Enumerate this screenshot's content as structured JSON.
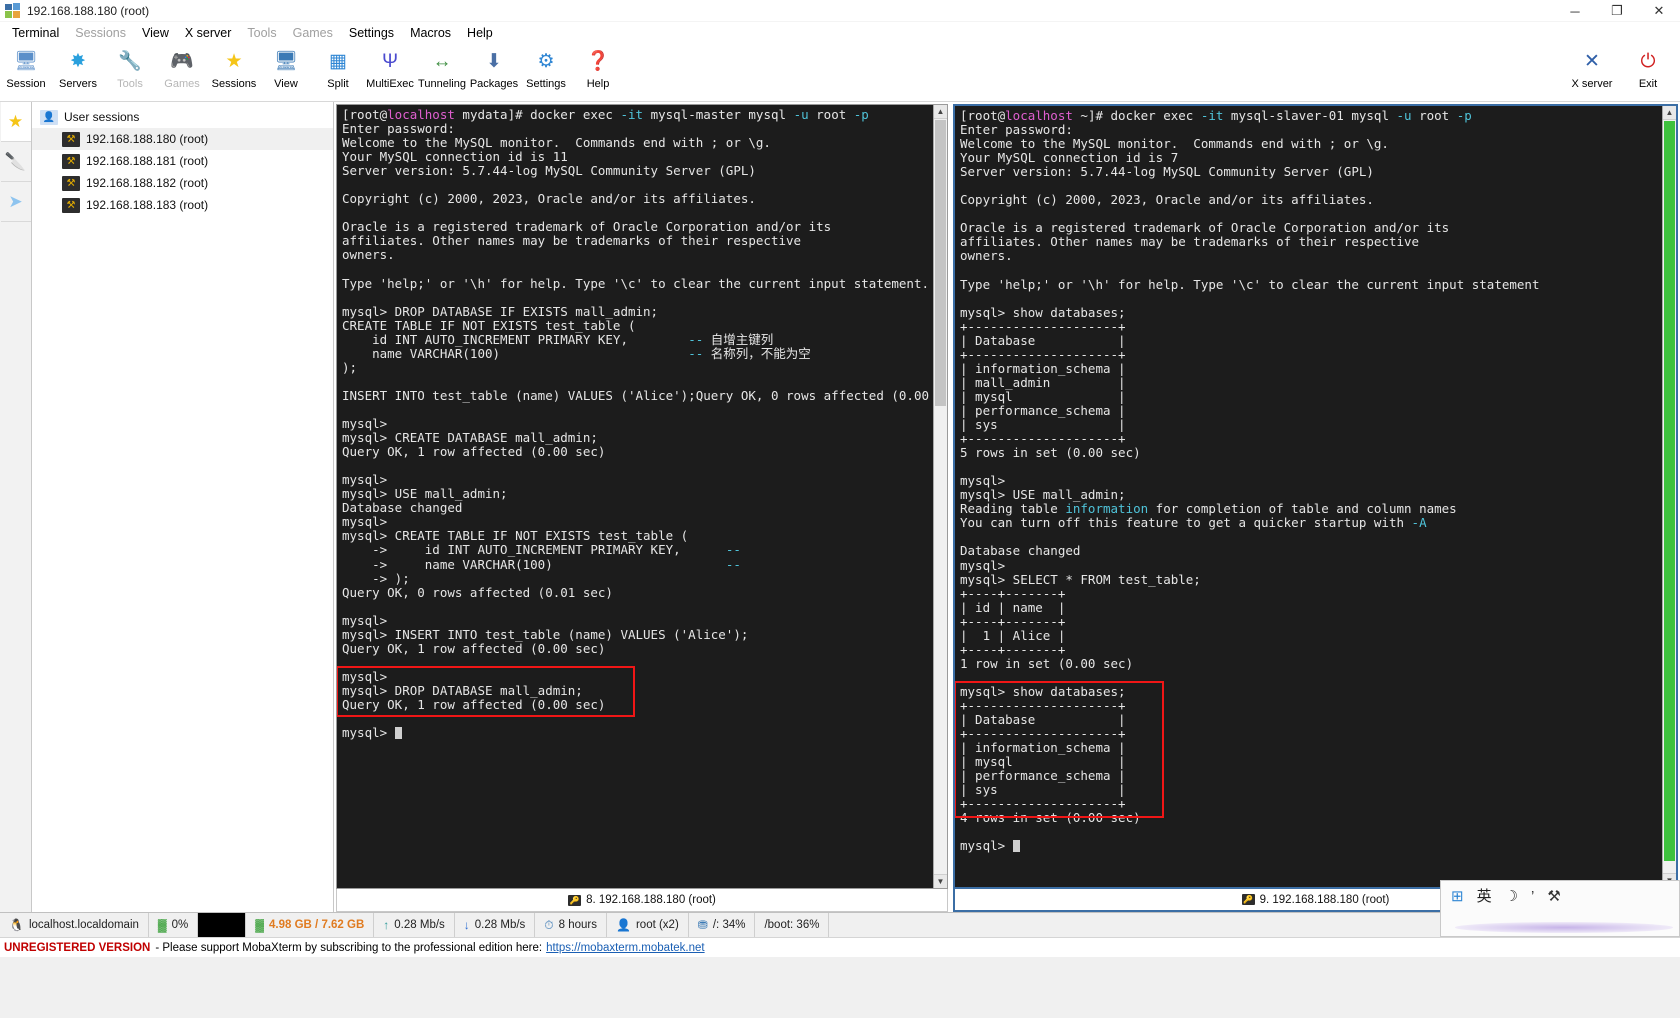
{
  "window": {
    "title": "192.168.188.180 (root)",
    "controls": {
      "minimize": "─",
      "maximize": "❐",
      "close": "✕"
    }
  },
  "menubar": [
    {
      "label": "Terminal",
      "enabled": true
    },
    {
      "label": "Sessions",
      "enabled": false
    },
    {
      "label": "View",
      "enabled": true
    },
    {
      "label": "X server",
      "enabled": true
    },
    {
      "label": "Tools",
      "enabled": false
    },
    {
      "label": "Games",
      "enabled": false
    },
    {
      "label": "Settings",
      "enabled": true
    },
    {
      "label": "Macros",
      "enabled": true
    },
    {
      "label": "Help",
      "enabled": true
    }
  ],
  "toolbar": {
    "buttons": [
      {
        "label": "Session",
        "icon": "session-icon",
        "glyph": "🖥",
        "color": "#5b8fc9",
        "enabled": true
      },
      {
        "label": "Servers",
        "icon": "servers-icon",
        "glyph": "✸",
        "color": "#2aa0dd",
        "enabled": true
      },
      {
        "label": "Tools",
        "icon": "tools-icon",
        "glyph": "🔧",
        "color": "#ef8a6a",
        "enabled": false
      },
      {
        "label": "Games",
        "icon": "games-icon",
        "glyph": "🎮",
        "color": "#b9c9b9",
        "enabled": false
      },
      {
        "label": "Sessions",
        "icon": "sessions-star-icon",
        "glyph": "★",
        "color": "#f5c518",
        "enabled": true
      },
      {
        "label": "View",
        "icon": "view-icon",
        "glyph": "🖥",
        "color": "#3b7ab5",
        "enabled": true
      },
      {
        "label": "Split",
        "icon": "split-icon",
        "glyph": "▦",
        "color": "#2f86d4",
        "enabled": true
      },
      {
        "label": "MultiExec",
        "icon": "multiexec-icon",
        "glyph": "Ψ",
        "color": "#4b4bcf",
        "enabled": true
      },
      {
        "label": "Tunneling",
        "icon": "tunneling-icon",
        "glyph": "↔",
        "color": "#3e8e41",
        "enabled": true
      },
      {
        "label": "Packages",
        "icon": "packages-icon",
        "glyph": "⬇",
        "color": "#4a6fa5",
        "enabled": true
      },
      {
        "label": "Settings",
        "icon": "settings-icon",
        "glyph": "⚙",
        "color": "#2f86d4",
        "enabled": true
      },
      {
        "label": "Help",
        "icon": "help-icon",
        "glyph": "❓",
        "color": "#1e7fd4",
        "enabled": true
      }
    ],
    "right_buttons": [
      {
        "label": "X server",
        "icon": "x-server-icon",
        "glyph": "✕",
        "color": "#2f5fa8",
        "enabled": true
      },
      {
        "label": "Exit",
        "icon": "exit-icon",
        "glyph": "⏻",
        "color": "#d02020",
        "enabled": true
      }
    ]
  },
  "sidebar": {
    "vertical_tabs": [
      {
        "icon": "star-icon",
        "glyph": "★",
        "color": "#f5c518",
        "active": true
      },
      {
        "icon": "tools-icon",
        "glyph": "🔪",
        "color": "#ef8a6a",
        "active": false
      },
      {
        "icon": "send-icon",
        "glyph": "➤",
        "color": "#8ec4ef",
        "active": false
      }
    ],
    "root_label": "User sessions",
    "sessions": [
      {
        "label": "192.168.188.180 (root)",
        "selected": true
      },
      {
        "label": "192.168.188.181 (root)",
        "selected": false
      },
      {
        "label": "192.168.188.182 (root)",
        "selected": false
      },
      {
        "label": "192.168.188.183 (root)",
        "selected": false
      }
    ]
  },
  "terminals": {
    "left": {
      "tab_label": "8. 192.168.188.180 (root)",
      "prompt_host": "localhost",
      "lines": [
        "[root@localhost mydata]# docker exec -it mysql-master mysql -u root -p",
        "Enter password:",
        "Welcome to the MySQL monitor.  Commands end with ; or \\g.",
        "Your MySQL connection id is 11",
        "Server version: 5.7.44-log MySQL Community Server (GPL)",
        "",
        "Copyright (c) 2000, 2023, Oracle and/or its affiliates.",
        "",
        "Oracle is a registered trademark of Oracle Corporation and/or its",
        "affiliates. Other names may be trademarks of their respective",
        "owners.",
        "",
        "Type 'help;' or '\\h' for help. Type '\\c' to clear the current input statement.",
        "",
        "mysql> DROP DATABASE IF EXISTS mall_admin;",
        "CREATE TABLE IF NOT EXISTS test_table (",
        "    id INT AUTO_INCREMENT PRIMARY KEY,        -- 自增主键列",
        "    name VARCHAR(100)                         -- 名称列，不能为空",
        ");",
        "",
        "INSERT INTO test_table (name) VALUES ('Alice');Query OK, 0 rows affected (0.00",
        "",
        "mysql>",
        "mysql> CREATE DATABASE mall_admin;",
        "Query OK, 1 row affected (0.00 sec)",
        "",
        "mysql>",
        "mysql> USE mall_admin;",
        "Database changed",
        "mysql>",
        "mysql> CREATE TABLE IF NOT EXISTS test_table (",
        "    ->     id INT AUTO_INCREMENT PRIMARY KEY,      --",
        "    ->     name VARCHAR(100)                       --",
        "    -> );",
        "Query OK, 0 rows affected (0.01 sec)",
        "",
        "mysql>",
        "mysql> INSERT INTO test_table (name) VALUES ('Alice');",
        "Query OK, 1 row affected (0.00 sec)",
        "",
        "mysql>",
        "mysql> DROP DATABASE mall_admin;",
        "Query OK, 1 row affected (0.00 sec)",
        "",
        "mysql> █"
      ]
    },
    "right": {
      "tab_label": "9. 192.168.188.180 (root)",
      "prompt_host": "localhost",
      "lines": [
        "[root@localhost ~]# docker exec -it mysql-slaver-01 mysql -u root -p",
        "Enter password:",
        "Welcome to the MySQL monitor.  Commands end with ; or \\g.",
        "Your MySQL connection id is 7",
        "Server version: 5.7.44-log MySQL Community Server (GPL)",
        "",
        "Copyright (c) 2000, 2023, Oracle and/or its affiliates.",
        "",
        "Oracle is a registered trademark of Oracle Corporation and/or its",
        "affiliates. Other names may be trademarks of their respective",
        "owners.",
        "",
        "Type 'help;' or '\\h' for help. Type '\\c' to clear the current input statement",
        "",
        "mysql> show databases;",
        "+--------------------+",
        "| Database           |",
        "+--------------------+",
        "| information_schema |",
        "| mall_admin         |",
        "| mysql              |",
        "| performance_schema |",
        "| sys                |",
        "+--------------------+",
        "5 rows in set (0.00 sec)",
        "",
        "mysql>",
        "mysql> USE mall_admin;",
        "Reading table information for completion of table and column names",
        "You can turn off this feature to get a quicker startup with -A",
        "",
        "Database changed",
        "mysql>",
        "mysql> SELECT * FROM test_table;",
        "+----+-------+",
        "| id | name  |",
        "+----+-------+",
        "|  1 | Alice |",
        "+----+-------+",
        "1 row in set (0.00 sec)",
        "",
        "mysql> show databases;",
        "+--------------------+",
        "| Database           |",
        "+--------------------+",
        "| information_schema |",
        "| mysql              |",
        "| performance_schema |",
        "| sys                |",
        "+--------------------+",
        "4 rows in set (0.00 sec)",
        "",
        "mysql> █"
      ]
    }
  },
  "statusbar": {
    "items": [
      {
        "icon": "linux-icon",
        "glyph": "🐧",
        "label": "localhost.localdomain",
        "color": "#cc3b2e"
      },
      {
        "icon": "cpu-icon",
        "glyph": "▓",
        "label": "0%",
        "color": "#3aa03a"
      },
      {
        "icon": "black-box",
        "glyph": "",
        "label": "",
        "color": "#000000"
      },
      {
        "icon": "memory-icon",
        "glyph": "▓",
        "label": "4.98 GB / 7.62 GB",
        "color": "#3aa03a",
        "highlight": "#e07b20"
      },
      {
        "icon": "upload-icon",
        "glyph": "↑",
        "label": "0.28 Mb/s",
        "color": "#2f9a9a"
      },
      {
        "icon": "download-icon",
        "glyph": "↓",
        "label": "0.28 Mb/s",
        "color": "#2f6fd4"
      },
      {
        "icon": "uptime-icon",
        "glyph": "⏱",
        "label": "8 hours",
        "color": "#3b7ab5"
      },
      {
        "icon": "user-icon",
        "glyph": "👤",
        "label": "root (x2)",
        "color": "#c86b30"
      },
      {
        "icon": "disk-icon",
        "glyph": "⛃",
        "label": "/: 34%",
        "color": "#3b7ab5"
      },
      {
        "icon": "boot-icon",
        "glyph": "",
        "label": "/boot: 36%",
        "color": "#333333"
      }
    ]
  },
  "tray": {
    "items": [
      {
        "icon": "windows-ime-icon",
        "glyph": "⊞",
        "color": "#2f86d4"
      },
      {
        "icon": "chinese-ime-icon",
        "glyph": "英",
        "color": "#222222"
      },
      {
        "icon": "moon-icon",
        "glyph": "☽",
        "color": "#333333"
      },
      {
        "icon": "comma-icon",
        "glyph": "’",
        "color": "#333333"
      },
      {
        "icon": "toolbox-icon",
        "glyph": "⚒",
        "color": "#333333"
      }
    ]
  },
  "nagbar": {
    "warning": "UNREGISTERED VERSION",
    "message": "- Please support MobaXterm by subscribing to the professional edition here:",
    "link": "https://mobaxterm.mobatek.net"
  }
}
